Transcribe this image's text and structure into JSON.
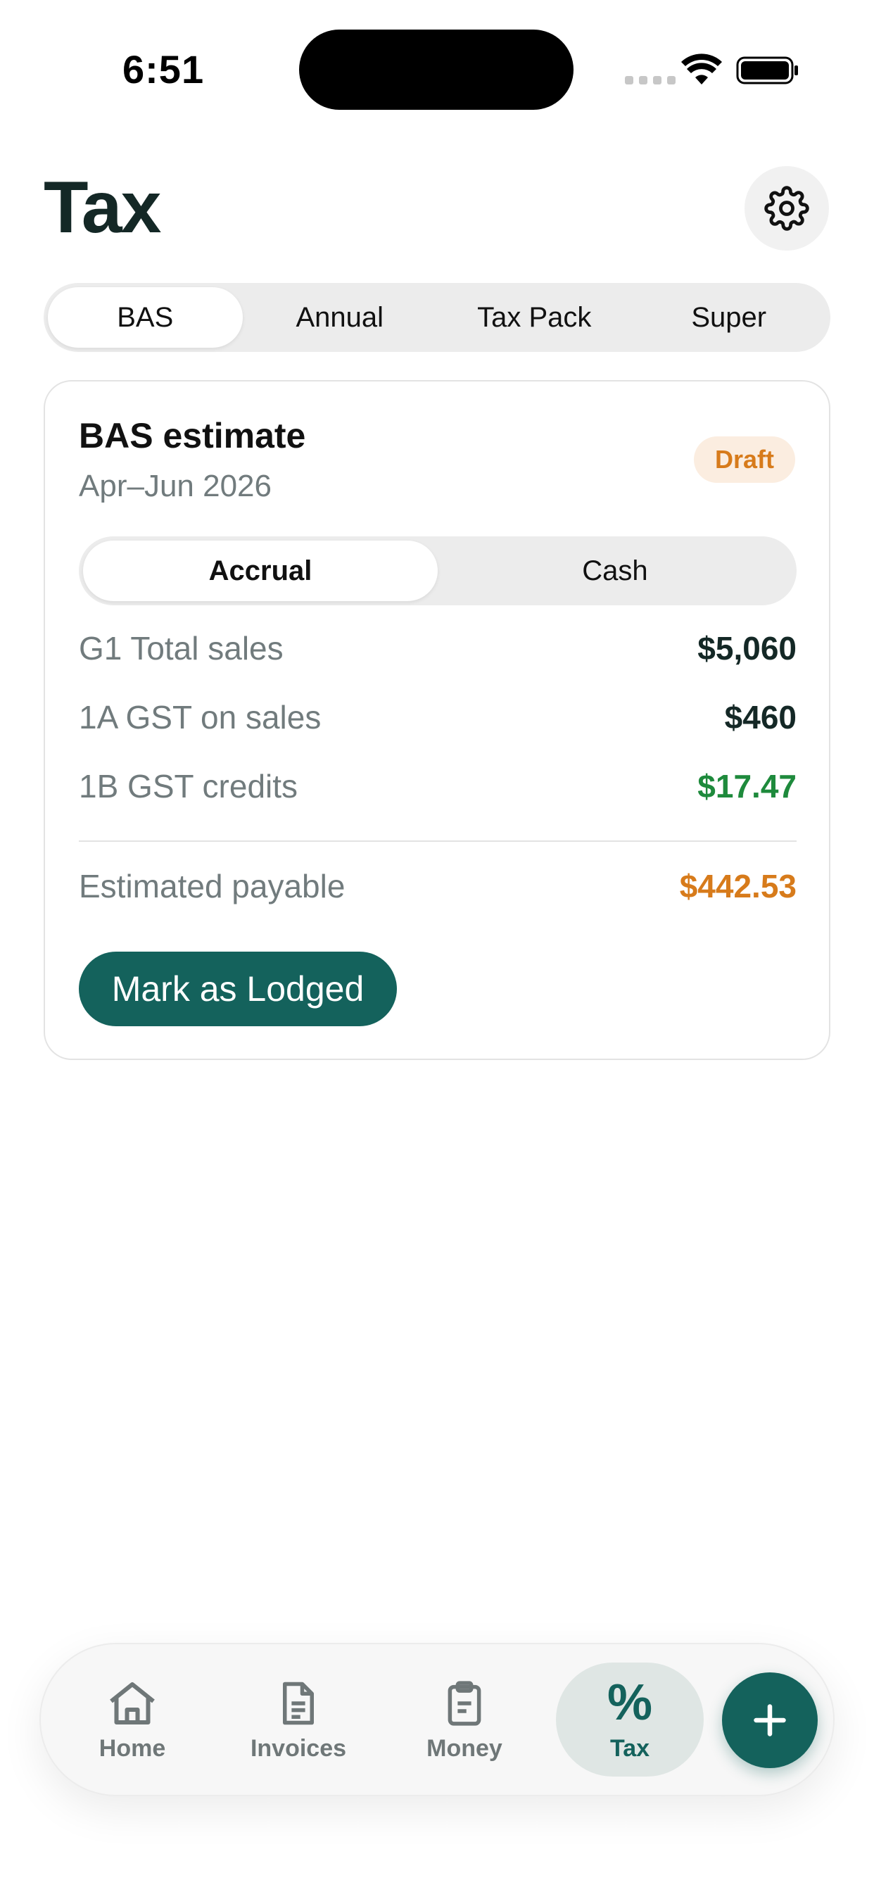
{
  "status_bar": {
    "time": "6:51"
  },
  "header": {
    "title": "Tax",
    "settings_icon": "gear-icon"
  },
  "tabs": [
    {
      "label": "BAS",
      "active": true
    },
    {
      "label": "Annual",
      "active": false
    },
    {
      "label": "Tax Pack",
      "active": false
    },
    {
      "label": "Super",
      "active": false
    }
  ],
  "bas_card": {
    "title": "BAS estimate",
    "period": "Apr–Jun 2026",
    "status": "Draft",
    "basis_options": [
      {
        "label": "Accrual",
        "active": true
      },
      {
        "label": "Cash",
        "active": false
      }
    ],
    "rows": [
      {
        "label": "G1 Total sales",
        "value": "$5,060"
      },
      {
        "label": "1A GST on sales",
        "value": "$460"
      },
      {
        "label": "1B GST credits",
        "value": "$17.47"
      }
    ],
    "total": {
      "label": "Estimated payable",
      "value": "$442.53"
    },
    "action_label": "Mark as Lodged"
  },
  "bottom_nav": {
    "items": [
      {
        "label": "Home",
        "icon": "home-icon",
        "active": false
      },
      {
        "label": "Invoices",
        "icon": "document-icon",
        "active": false
      },
      {
        "label": "Money",
        "icon": "clipboard-icon",
        "active": false
      },
      {
        "label": "Tax",
        "icon": "percent-icon",
        "glyph": "%",
        "active": true
      }
    ],
    "fab_icon": "plus-icon"
  },
  "colors": {
    "brand": "#14625c",
    "credit_green": "#1e8a3c",
    "payable_orange": "#d77b1b",
    "muted_text": "#717b7d"
  }
}
